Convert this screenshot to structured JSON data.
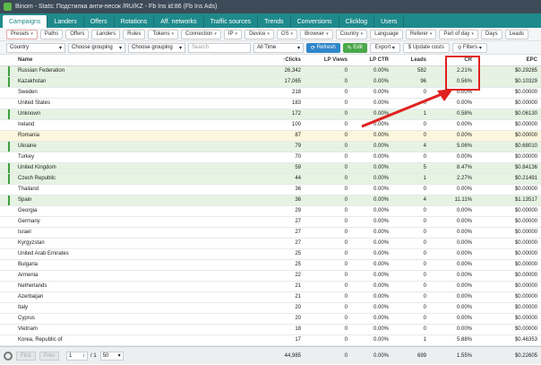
{
  "window": {
    "title": "Binom - Stats: Подстилка анти-песок /RU/KZ - Fb Ins id:86 (Fb Ins Ads)"
  },
  "tabs": [
    "Campaigns",
    "Landers",
    "Offers",
    "Rotations",
    "Aff. networks",
    "Traffic sources",
    "Trends",
    "Conversions",
    "Clicklog",
    "Users"
  ],
  "toolbar1": [
    "Presets",
    "Paths",
    "Offers",
    "Landers",
    "Rules",
    "Tokens",
    "Connection",
    "IP",
    "Device",
    "OS",
    "Browser",
    "Country",
    "Language",
    "Referer",
    "Part of day",
    "Days",
    "Leads"
  ],
  "toolbar2": {
    "group1": "Country",
    "group2": "Choose grouping",
    "group3": "Choose grouping",
    "search_placeholder": "Search",
    "period": "All Time",
    "refresh": "Refresh",
    "edit": "Edit",
    "export": "Export",
    "update_costs": "Update costs",
    "filters": "Filters"
  },
  "columns": {
    "name": "Name",
    "clicks": "Clicks",
    "lp_views": "LP Views",
    "lp_ctr": "LP CTR",
    "leads": "Leads",
    "cr": "CR",
    "epc": "EPC"
  },
  "rows": [
    {
      "name": "Russian Federation",
      "clicks": "26,342",
      "lpv": "0",
      "lpctr": "0.00%",
      "leads": "582",
      "cr": "2.21%",
      "epc": "$0.29285",
      "c": "green"
    },
    {
      "name": "Kazakhstan",
      "clicks": "17,065",
      "lpv": "0",
      "lpctr": "0.00%",
      "leads": "96",
      "cr": "0.56%",
      "epc": "$0.10329",
      "c": "green"
    },
    {
      "name": "Sweden",
      "clicks": "218",
      "lpv": "0",
      "lpctr": "0.00%",
      "leads": "0",
      "cr": "0.00%",
      "epc": "$0.00000",
      "c": "white"
    },
    {
      "name": "United States",
      "clicks": "183",
      "lpv": "0",
      "lpctr": "0.00%",
      "leads": "0",
      "cr": "0.00%",
      "epc": "$0.00000",
      "c": "white"
    },
    {
      "name": "Unknown",
      "clicks": "172",
      "lpv": "0",
      "lpctr": "0.00%",
      "leads": "1",
      "cr": "0.58%",
      "epc": "$0.06130",
      "c": "green"
    },
    {
      "name": "Ireland",
      "clicks": "100",
      "lpv": "0",
      "lpctr": "0.00%",
      "leads": "0",
      "cr": "0.00%",
      "epc": "$0.00000",
      "c": "white"
    },
    {
      "name": "Romania",
      "clicks": "87",
      "lpv": "0",
      "lpctr": "0.00%",
      "leads": "0",
      "cr": "0.00%",
      "epc": "$0.00000",
      "c": "yellow"
    },
    {
      "name": "Ukraine",
      "clicks": "79",
      "lpv": "0",
      "lpctr": "0.00%",
      "leads": "4",
      "cr": "5.06%",
      "epc": "$0.68010",
      "c": "green"
    },
    {
      "name": "Turkey",
      "clicks": "70",
      "lpv": "0",
      "lpctr": "0.00%",
      "leads": "0",
      "cr": "0.00%",
      "epc": "$0.00000",
      "c": "white"
    },
    {
      "name": "United Kingdom",
      "clicks": "59",
      "lpv": "0",
      "lpctr": "0.00%",
      "leads": "5",
      "cr": "8.47%",
      "epc": "$0.84136",
      "c": "green"
    },
    {
      "name": "Czech Republic",
      "clicks": "44",
      "lpv": "0",
      "lpctr": "0.00%",
      "leads": "1",
      "cr": "2.27%",
      "epc": "$0.21491",
      "c": "green"
    },
    {
      "name": "Thailand",
      "clicks": "36",
      "lpv": "0",
      "lpctr": "0.00%",
      "leads": "0",
      "cr": "0.00%",
      "epc": "$0.00000",
      "c": "white"
    },
    {
      "name": "Spain",
      "clicks": "36",
      "lpv": "0",
      "lpctr": "0.00%",
      "leads": "4",
      "cr": "11.11%",
      "epc": "$1.13517",
      "c": "green"
    },
    {
      "name": "Georgia",
      "clicks": "29",
      "lpv": "0",
      "lpctr": "0.00%",
      "leads": "0",
      "cr": "0.00%",
      "epc": "$0.00000",
      "c": "white"
    },
    {
      "name": "Germany",
      "clicks": "27",
      "lpv": "0",
      "lpctr": "0.00%",
      "leads": "0",
      "cr": "0.00%",
      "epc": "$0.00000",
      "c": "white"
    },
    {
      "name": "Israel",
      "clicks": "27",
      "lpv": "0",
      "lpctr": "0.00%",
      "leads": "0",
      "cr": "0.00%",
      "epc": "$0.00000",
      "c": "white"
    },
    {
      "name": "Kyrgyzstan",
      "clicks": "27",
      "lpv": "0",
      "lpctr": "0.00%",
      "leads": "0",
      "cr": "0.00%",
      "epc": "$0.00000",
      "c": "white"
    },
    {
      "name": "United Arab Emirates",
      "clicks": "25",
      "lpv": "0",
      "lpctr": "0.00%",
      "leads": "0",
      "cr": "0.00%",
      "epc": "$0.00000",
      "c": "white"
    },
    {
      "name": "Bulgaria",
      "clicks": "25",
      "lpv": "0",
      "lpctr": "0.00%",
      "leads": "0",
      "cr": "0.00%",
      "epc": "$0.00000",
      "c": "white"
    },
    {
      "name": "Armenia",
      "clicks": "22",
      "lpv": "0",
      "lpctr": "0.00%",
      "leads": "0",
      "cr": "0.00%",
      "epc": "$0.00000",
      "c": "white"
    },
    {
      "name": "Netherlands",
      "clicks": "21",
      "lpv": "0",
      "lpctr": "0.00%",
      "leads": "0",
      "cr": "0.00%",
      "epc": "$0.00000",
      "c": "white"
    },
    {
      "name": "Azerbaijan",
      "clicks": "21",
      "lpv": "0",
      "lpctr": "0.00%",
      "leads": "0",
      "cr": "0.00%",
      "epc": "$0.00000",
      "c": "white"
    },
    {
      "name": "Italy",
      "clicks": "20",
      "lpv": "0",
      "lpctr": "0.00%",
      "leads": "0",
      "cr": "0.00%",
      "epc": "$0.00000",
      "c": "white"
    },
    {
      "name": "Cyprus",
      "clicks": "20",
      "lpv": "0",
      "lpctr": "0.00%",
      "leads": "0",
      "cr": "0.00%",
      "epc": "$0.00000",
      "c": "white"
    },
    {
      "name": "Vietnam",
      "clicks": "18",
      "lpv": "0",
      "lpctr": "0.00%",
      "leads": "0",
      "cr": "0.00%",
      "epc": "$0.00000",
      "c": "white"
    },
    {
      "name": "Korea, Republic of",
      "clicks": "17",
      "lpv": "0",
      "lpctr": "0.00%",
      "leads": "1",
      "cr": "5.88%",
      "epc": "$0.46353",
      "c": "white"
    }
  ],
  "footer": {
    "first": "First",
    "prev": "Prev",
    "page": "1",
    "of_pages": "/ 1",
    "per_page": "50",
    "total_clicks": "44,985",
    "total_lpv": "0",
    "total_lpctr": "0.00%",
    "total_leads": "699",
    "total_cr": "1.55%",
    "total_epc": "$0.22605"
  },
  "colors": {
    "tabs_bg": "#1f8a8c",
    "green_row": "#e6f3e2",
    "yellow_row": "#fcf6dc",
    "annotation": "#e0201f"
  }
}
